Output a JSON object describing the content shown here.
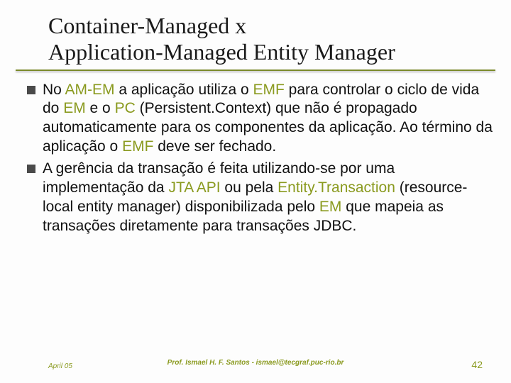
{
  "title": {
    "line1": "Container-Managed x",
    "line2": "Application-Managed Entity Manager"
  },
  "bullets": [
    {
      "segments": [
        {
          "t": "No ",
          "hl": false
        },
        {
          "t": "AM-EM",
          "hl": true
        },
        {
          "t": " a aplicação utiliza o ",
          "hl": false
        },
        {
          "t": "EMF",
          "hl": true
        },
        {
          "t": " para controlar o ciclo de vida do ",
          "hl": false
        },
        {
          "t": "EM",
          "hl": true
        },
        {
          "t": " e o ",
          "hl": false
        },
        {
          "t": "PC",
          "hl": true
        },
        {
          "t": " (Persistent.Context) que não é propagado automaticamente para os componentes da aplicação. Ao término da aplicação o ",
          "hl": false
        },
        {
          "t": "EMF",
          "hl": true
        },
        {
          "t": " deve ser fechado.",
          "hl": false
        }
      ]
    },
    {
      "segments": [
        {
          "t": "A gerência da transação é feita utilizando-se por uma implementação da ",
          "hl": false
        },
        {
          "t": "JTA API",
          "hl": true
        },
        {
          "t": " ou pela ",
          "hl": false
        },
        {
          "t": "Entity.Transaction",
          "hl": true
        },
        {
          "t": " (resource-local entity manager) disponibilizada pelo ",
          "hl": false
        },
        {
          "t": "EM",
          "hl": true
        },
        {
          "t": " que mapeia as transações diretamente para transações JDBC.",
          "hl": false
        }
      ]
    }
  ],
  "footer": {
    "left": "April 05",
    "center": "Prof. Ismael H. F. Santos -  ismael@tecgraf.puc-rio.br",
    "right": "42"
  }
}
